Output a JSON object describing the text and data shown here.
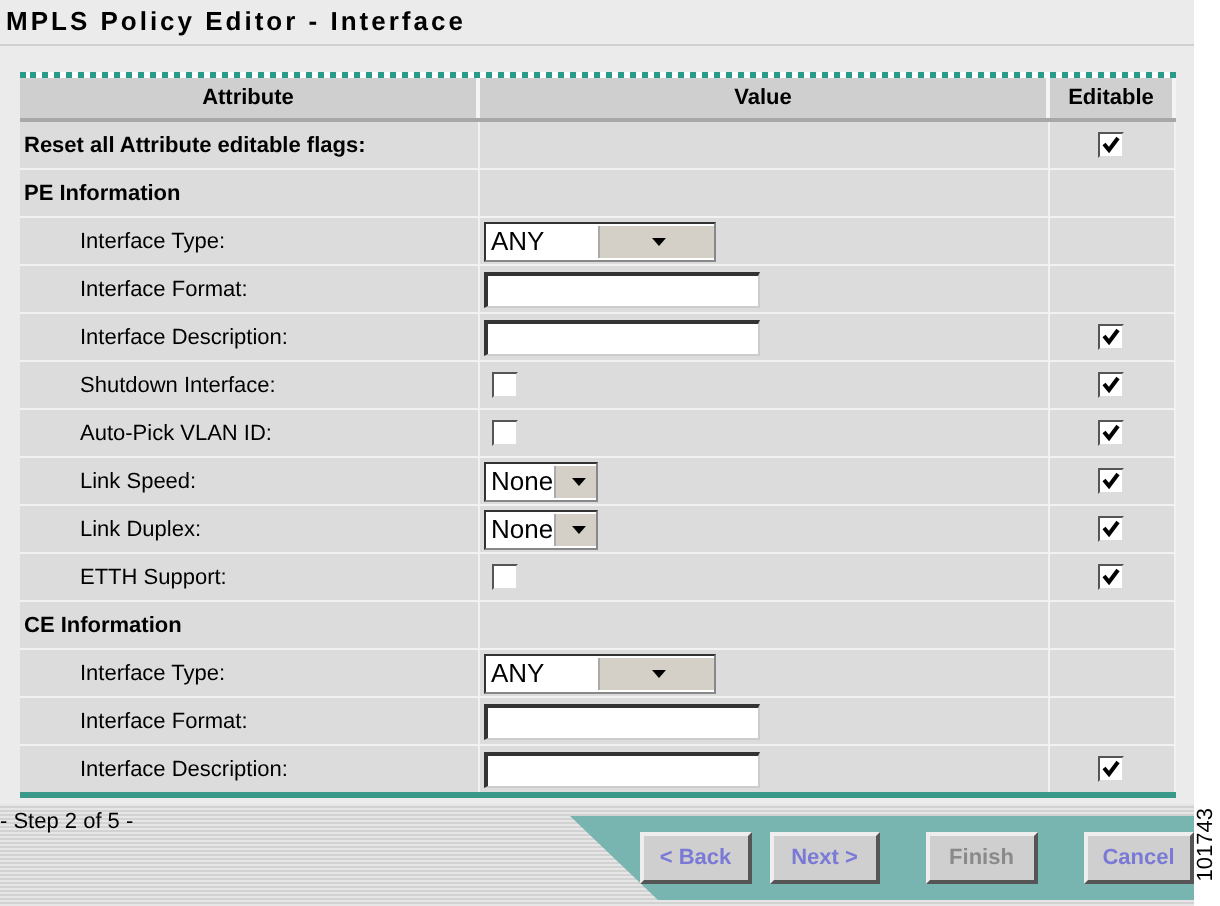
{
  "title": "MPLS Policy Editor - Interface",
  "columns": [
    "Attribute",
    "Value",
    "Editable"
  ],
  "rows": [
    {
      "kind": "reset",
      "label": "Reset all Attribute editable flags:",
      "editable": true,
      "checked": true
    },
    {
      "kind": "section",
      "label": "PE Information",
      "editable": false
    },
    {
      "kind": "field",
      "label": "Interface Type:",
      "value": {
        "kind": "combo",
        "text": "ANY"
      },
      "editable": false
    },
    {
      "kind": "field",
      "label": "Interface Format:",
      "value": {
        "kind": "text"
      },
      "editable": false
    },
    {
      "kind": "field",
      "label": "Interface Description:",
      "value": {
        "kind": "text"
      },
      "editable": true,
      "checked": true
    },
    {
      "kind": "field",
      "label": "Shutdown Interface:",
      "value": {
        "kind": "checkbox",
        "checked": false
      },
      "editable": true,
      "checked": true
    },
    {
      "kind": "field",
      "label": "Auto-Pick VLAN ID:",
      "value": {
        "kind": "checkbox",
        "checked": false
      },
      "editable": true,
      "checked": true
    },
    {
      "kind": "field",
      "label": "Link Speed:",
      "value": {
        "kind": "select",
        "text": "None"
      },
      "editable": true,
      "checked": true
    },
    {
      "kind": "field",
      "label": "Link Duplex:",
      "value": {
        "kind": "select",
        "text": "None"
      },
      "editable": true,
      "checked": true
    },
    {
      "kind": "field",
      "label": "ETTH Support:",
      "value": {
        "kind": "checkbox",
        "checked": false
      },
      "editable": true,
      "checked": true
    },
    {
      "kind": "section",
      "label": "CE Information",
      "editable": false
    },
    {
      "kind": "field",
      "label": "Interface Type:",
      "value": {
        "kind": "combo",
        "text": "ANY"
      },
      "editable": false
    },
    {
      "kind": "field",
      "label": "Interface Format:",
      "value": {
        "kind": "text"
      },
      "editable": false
    },
    {
      "kind": "field",
      "label": "Interface Description:",
      "value": {
        "kind": "text"
      },
      "editable": true,
      "checked": true
    }
  ],
  "step": "- Step 2 of 5 -",
  "buttons": [
    {
      "label": "< Back",
      "disabled": false
    },
    {
      "label": "Next >",
      "disabled": false
    },
    {
      "label": "Finish",
      "disabled": true
    },
    {
      "label": "Cancel",
      "disabled": false
    }
  ],
  "figure_number": "101743"
}
